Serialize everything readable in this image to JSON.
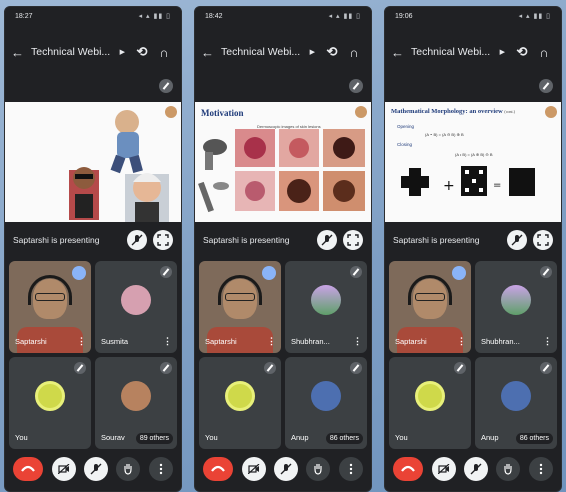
{
  "phones": [
    {
      "time": "18:27",
      "title": "Technical Webi...",
      "presenting": "Saptarshi is presenting",
      "tiles": [
        {
          "name": "Saptarshi"
        },
        {
          "name": "Susmita"
        },
        {
          "name": "You"
        },
        {
          "name": "Sourav",
          "others": "89 others"
        }
      ]
    },
    {
      "time": "18:42",
      "title": "Technical Webi...",
      "presenting": "Saptarshi is presenting",
      "slide_title": "Motivation",
      "slide_caption": "Dermoscopic images of skin lesions",
      "tiles": [
        {
          "name": "Saptarshi"
        },
        {
          "name": "Shubhran..."
        },
        {
          "name": "You"
        },
        {
          "name": "Anup",
          "others": "86 others"
        }
      ]
    },
    {
      "time": "19:06",
      "title": "Technical Webi...",
      "presenting": "Saptarshi is presenting",
      "slide_title": "Mathematical Morphology: an overview",
      "slide_page": "(cont.)",
      "slide_items": [
        "Opening",
        "Closing"
      ],
      "slide_formula_1": "(A ∘ B) = (A ⊖ B) ⊕ B",
      "slide_formula_2": "(A • B) = (A ⊕ B) ⊖ B",
      "tiles": [
        {
          "name": "Saptarshi"
        },
        {
          "name": "Shubhran..."
        },
        {
          "name": "You"
        },
        {
          "name": "Anup",
          "others": "86 others"
        }
      ]
    }
  ],
  "colors": {
    "background": "#202124",
    "tile": "#3c4043",
    "end_call": "#ea4335",
    "speaking": "#8ab4f8"
  },
  "icons": [
    "back-arrow-icon",
    "switch-camera-icon",
    "headphones-icon",
    "mic-off-icon",
    "fullscreen-icon",
    "end-call-icon",
    "camera-off-icon",
    "raise-hand-icon",
    "more-icon"
  ]
}
